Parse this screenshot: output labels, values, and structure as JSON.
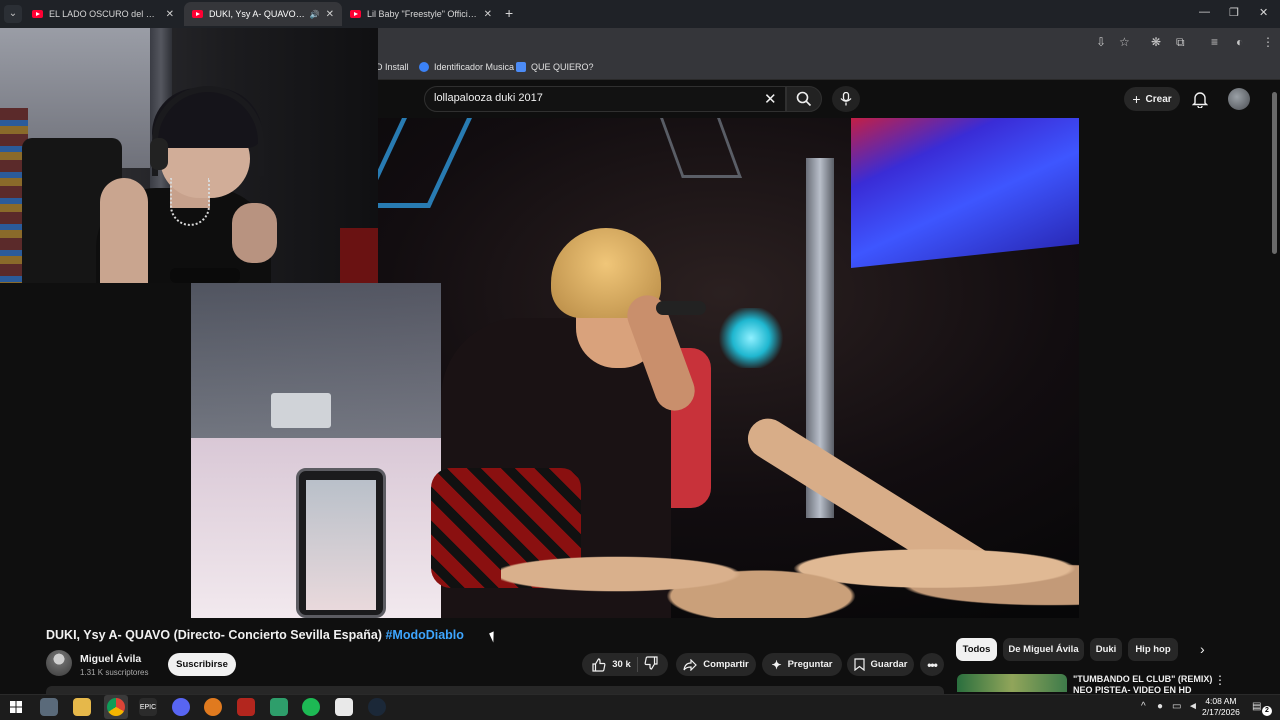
{
  "browser": {
    "tabs": [
      {
        "title": "EL LADO OSCURO del ÉXITO de",
        "active": false,
        "close": "✕"
      },
      {
        "title": "DUKI, Ysy A- QUAVO (Directo",
        "active": true,
        "close": "✕",
        "audio": "🔊"
      },
      {
        "title": "Lil Baby \"Freestyle\" Official Mu",
        "active": false,
        "close": "✕"
      }
    ],
    "new_tab": "+",
    "window_controls": [
      "—",
      "❐",
      "✕"
    ],
    "bookmarks": [
      {
        "label": "D Install",
        "icon": "bookmark-icon"
      },
      {
        "label": "Identificador Musica",
        "icon": "shazam-icon"
      },
      {
        "label": "QUE QUIERO?",
        "icon": "docs-icon"
      }
    ]
  },
  "youtube": {
    "search": {
      "value": "lollapalooza duki 2017",
      "clear": "✕"
    },
    "create_label": "Crear",
    "video": {
      "title": "DUKI, Ysy A- QUAVO (Directo- Concierto Sevilla España)",
      "hashtag": "#ModoDiablo"
    },
    "channel": {
      "name": "Miguel Ávila",
      "subscribers": "1.31 K suscriptores",
      "subscribe_label": "Suscribirse"
    },
    "actions": {
      "likes": "30 k",
      "share": "Compartir",
      "ask": "Preguntar",
      "save": "Guardar"
    },
    "chips": [
      "Todos",
      "De Miguel Ávila",
      "Duki",
      "Hip hop"
    ],
    "recommendation": {
      "title": "\"TUMBANDO EL CLUB\" (REMIX) NEO PISTEA- VIDEO EN HD"
    }
  },
  "taskbar": {
    "time": "4:08 AM",
    "date": "2/17/2026",
    "notifications": "2"
  },
  "colors": {
    "accent_link": "#3ea6ff",
    "youtube_red": "#ff0033",
    "background": "#0f0f0f"
  }
}
